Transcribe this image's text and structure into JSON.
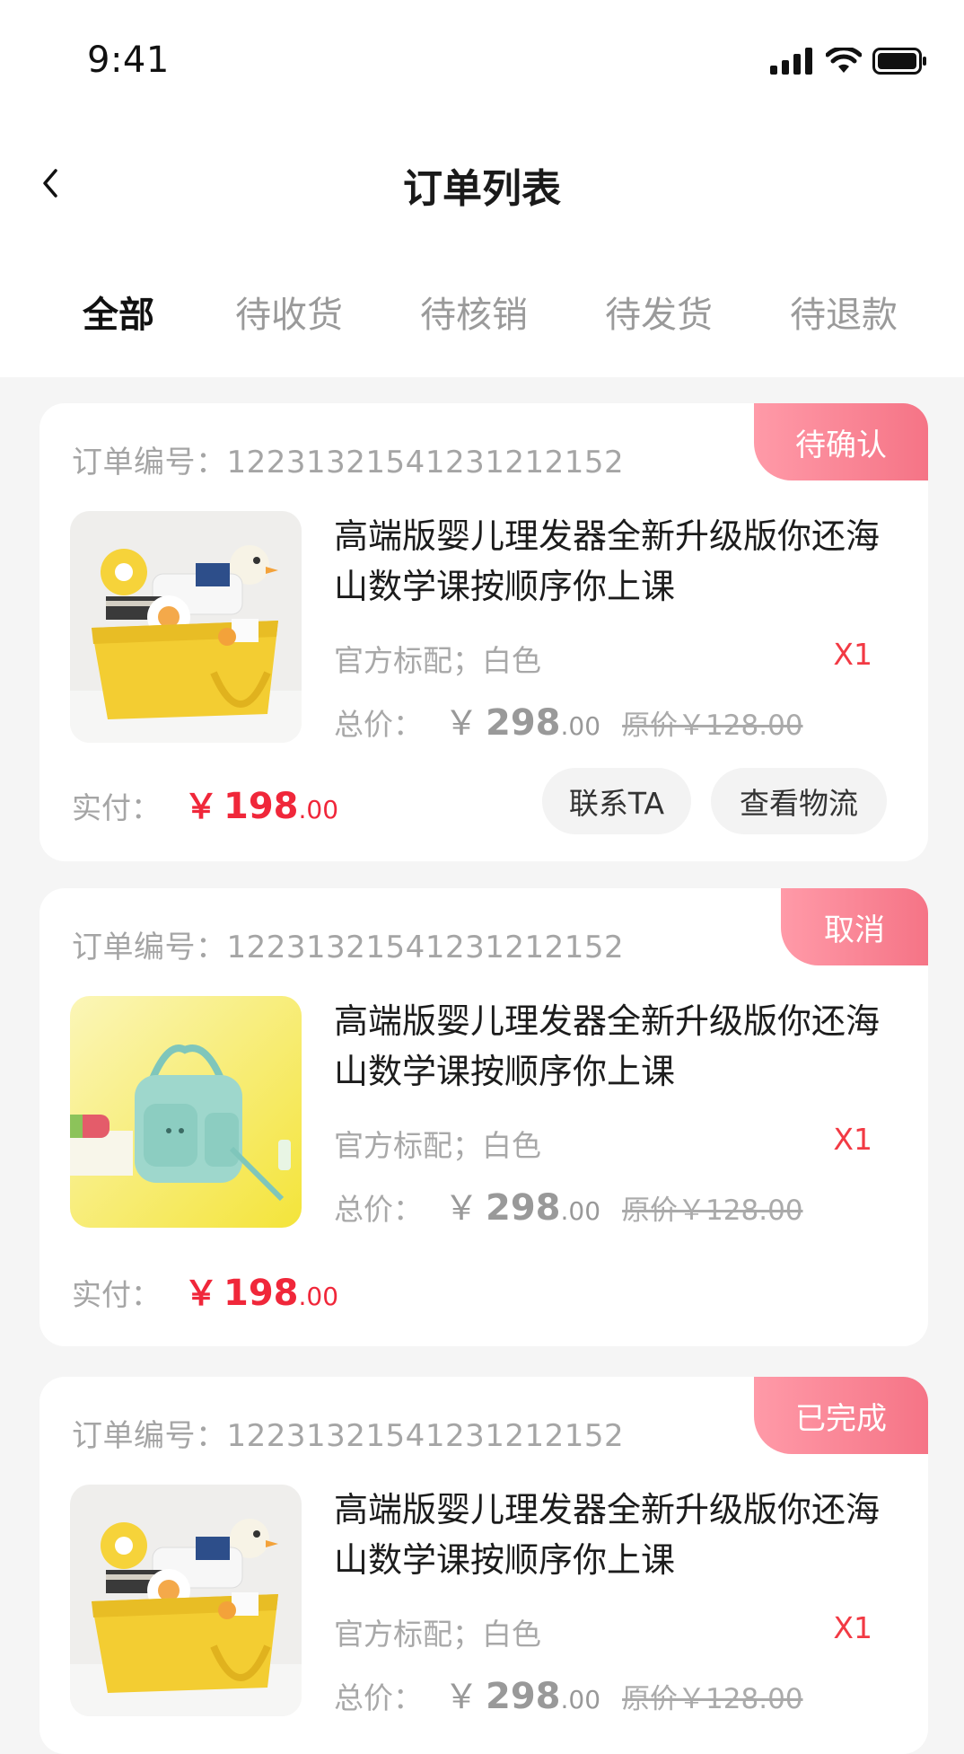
{
  "status_bar": {
    "time": "9:41",
    "signal_icon": "signal-icon",
    "wifi_icon": "wifi-icon",
    "battery_icon": "battery-icon"
  },
  "nav": {
    "back_icon": "chevron-left-icon",
    "title": "订单列表"
  },
  "tabs": [
    {
      "label": "全部",
      "active": true
    },
    {
      "label": "待收货",
      "active": false
    },
    {
      "label": "待核销",
      "active": false
    },
    {
      "label": "待发货",
      "active": false
    },
    {
      "label": "待退款",
      "active": false
    }
  ],
  "orders": [
    {
      "order_no_label": "订单编号：",
      "order_no": "12231321541231212152",
      "status": "待确认",
      "thumbnail": "yellow-diaper-caddy-image",
      "title": "高端版婴儿理发器全新升级版你还海山数学课按顺序你上课",
      "spec": "官方标配；白色",
      "qty": "X1",
      "total_label": "总价：",
      "total_yen": "￥",
      "total_int": "298",
      "total_dec": ".00",
      "original": "原价￥128.00",
      "paid_label": "实付：",
      "paid_yen": "￥",
      "paid_int": "198",
      "paid_dec": ".00",
      "buttons": [
        "联系TA",
        "查看物流"
      ]
    },
    {
      "order_no_label": "订单编号：",
      "order_no": "12231321541231212152",
      "status": "取消",
      "thumbnail": "mint-diaper-bag-image",
      "title": "高端版婴儿理发器全新升级版你还海山数学课按顺序你上课",
      "spec": "官方标配；白色",
      "qty": "X1",
      "total_label": "总价：",
      "total_yen": "￥",
      "total_int": "298",
      "total_dec": ".00",
      "original": "原价￥128.00",
      "paid_label": "实付：",
      "paid_yen": "￥",
      "paid_int": "198",
      "paid_dec": ".00",
      "buttons": []
    },
    {
      "order_no_label": "订单编号：",
      "order_no": "12231321541231212152",
      "status": "已完成",
      "thumbnail": "yellow-diaper-caddy-image",
      "title": "高端版婴儿理发器全新升级版你还海山数学课按顺序你上课",
      "spec": "官方标配；白色",
      "qty": "X1",
      "total_label": "总价：",
      "total_yen": "￥",
      "total_int": "298",
      "total_dec": ".00",
      "original": "原价￥128.00",
      "buttons": []
    }
  ],
  "colors": {
    "accent_red": "#f0273a",
    "tag_gradient_start": "#ff9aa8",
    "tag_gradient_end": "#f57486",
    "page_bg": "#f5f5f5"
  }
}
